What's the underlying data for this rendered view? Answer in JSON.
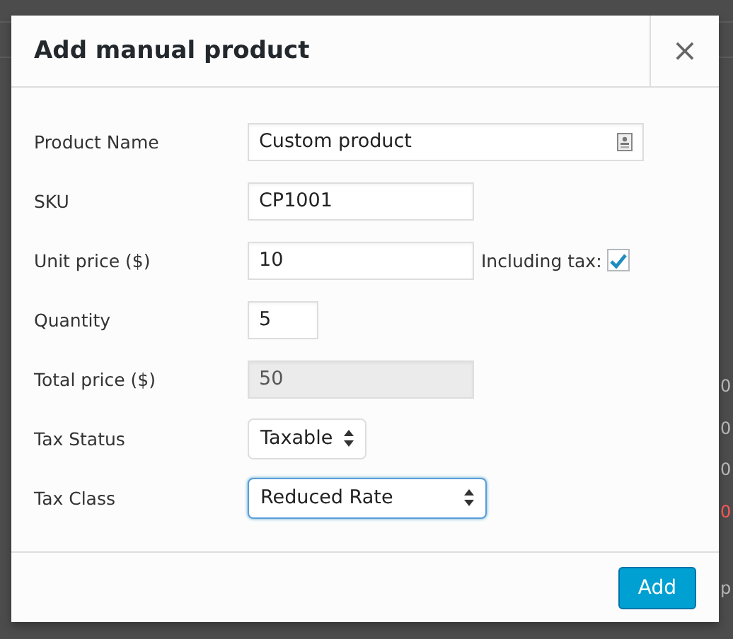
{
  "background_page": {
    "amounts": [
      {
        "text": "0",
        "negative": false
      },
      {
        "text": "0",
        "negative": false
      },
      {
        "text": "0",
        "negative": false
      },
      {
        "text": "0",
        "negative": true
      }
    ],
    "footer_text": "p"
  },
  "dialog": {
    "title": "Add manual product",
    "close_label": "×"
  },
  "fields": [
    {
      "kind": "wide-text",
      "label": "Product Name",
      "value": "Custom product",
      "disabled": false
    },
    {
      "kind": "text",
      "label": "SKU",
      "value": "CP1001",
      "disabled": false
    },
    {
      "kind": "text",
      "label": "Unit price ($)",
      "value": "10",
      "disabled": false,
      "addon": {
        "label": "Including tax:",
        "checked": true
      }
    },
    {
      "kind": "short-text",
      "label": "Quantity",
      "value": "5",
      "disabled": false
    },
    {
      "kind": "text",
      "label": "Total price ($)",
      "value": "50",
      "disabled": true
    },
    {
      "kind": "small-select",
      "label": "Tax Status",
      "value": "Taxable",
      "focused": false
    },
    {
      "kind": "select",
      "label": "Tax Class",
      "value": "Reduced Rate",
      "focused": true
    }
  ],
  "buttons": [
    {
      "label": "Add",
      "primary": true
    }
  ]
}
